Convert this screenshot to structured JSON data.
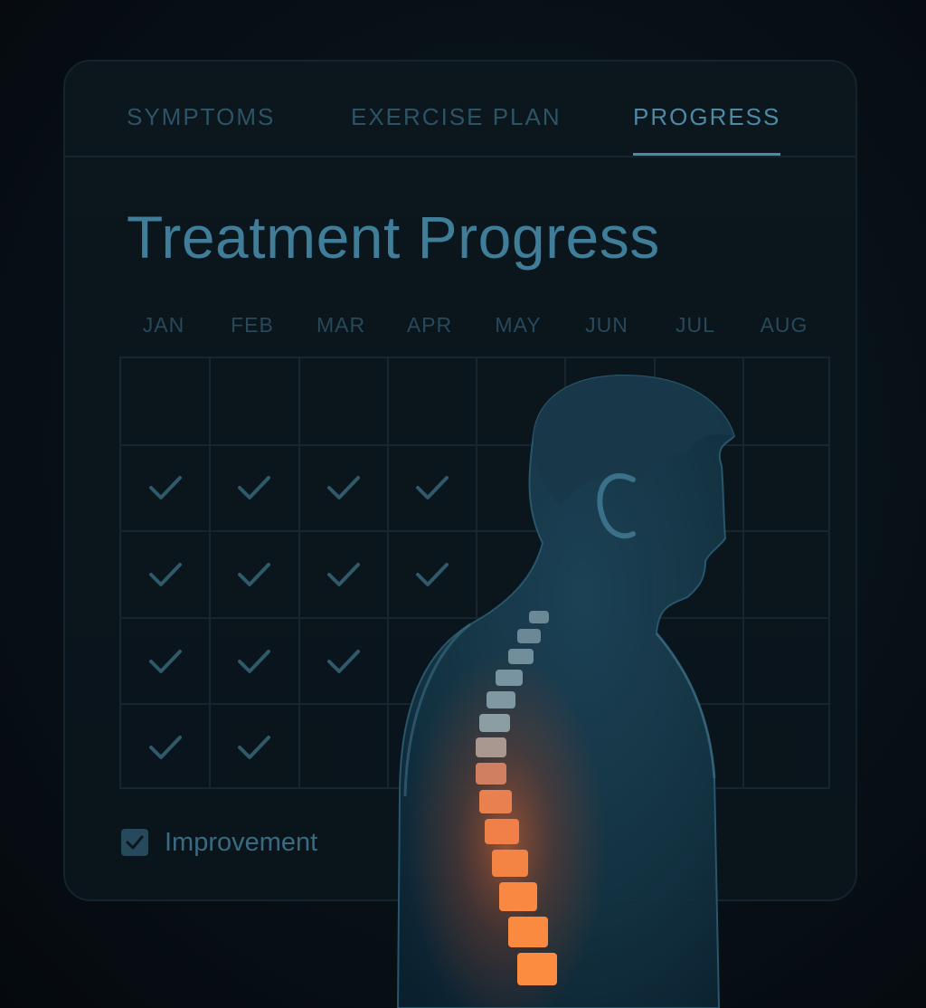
{
  "tabs": [
    {
      "label": "SYMPTOMS",
      "active": false
    },
    {
      "label": "EXERCISE PLAN",
      "active": false
    },
    {
      "label": "PROGRESS",
      "active": true
    }
  ],
  "title": "Treatment Progress",
  "months": [
    "JAN",
    "FEB",
    "MAR",
    "APR",
    "MAY",
    "JUN",
    "JUL",
    "AUG"
  ],
  "grid": {
    "rows": 5,
    "checks": [
      [
        false,
        false,
        false,
        false,
        false,
        false,
        false,
        false
      ],
      [
        true,
        true,
        true,
        true,
        false,
        false,
        false,
        false
      ],
      [
        true,
        true,
        true,
        true,
        false,
        false,
        false,
        false
      ],
      [
        true,
        true,
        true,
        false,
        false,
        false,
        false,
        false
      ],
      [
        true,
        true,
        false,
        false,
        false,
        false,
        false,
        false
      ]
    ]
  },
  "legend": {
    "label": "Improvement",
    "checked": true
  },
  "colors": {
    "accent": "#4d8aa6",
    "check": "#2f5a6c",
    "spine_glow": "#ff6a2c",
    "background": "#081118"
  },
  "icons": {
    "check": "check-icon",
    "figure": "human-silhouette-spine"
  }
}
